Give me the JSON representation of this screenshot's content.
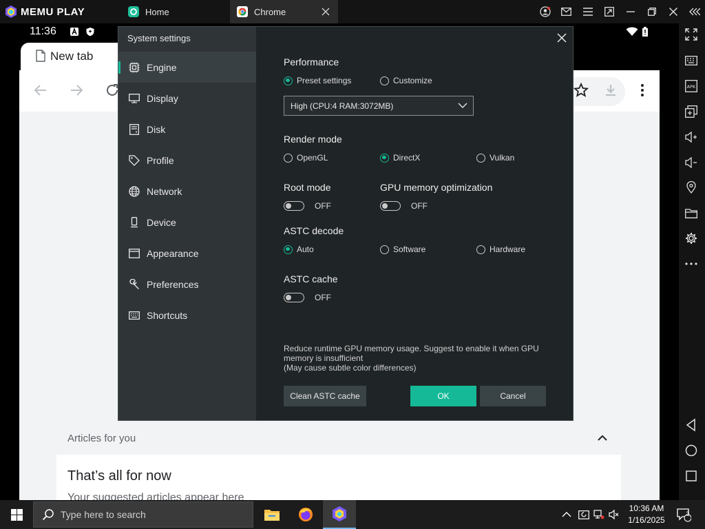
{
  "emulator": {
    "brand": "MEMU PLAY",
    "tabs": [
      {
        "label": "Home"
      },
      {
        "label": "Chrome"
      }
    ]
  },
  "android_status": {
    "time": "11:36"
  },
  "chrome": {
    "tab_title": "New tab",
    "articles_label": "Articles for you",
    "card_title": "That’s all for now",
    "card_subtitle": "Your suggested articles appear here"
  },
  "dialog": {
    "title": "System settings",
    "nav": [
      {
        "label": "Engine",
        "icon": "chip-icon",
        "active": true
      },
      {
        "label": "Display",
        "icon": "monitor-icon"
      },
      {
        "label": "Disk",
        "icon": "disk-icon"
      },
      {
        "label": "Profile",
        "icon": "tag-icon"
      },
      {
        "label": "Network",
        "icon": "globe-icon"
      },
      {
        "label": "Device",
        "icon": "phone-icon"
      },
      {
        "label": "Appearance",
        "icon": "window-icon"
      },
      {
        "label": "Preferences",
        "icon": "wrench-icon"
      },
      {
        "label": "Shortcuts",
        "icon": "keyboard-icon"
      }
    ],
    "performance": {
      "heading": "Performance",
      "options": [
        "Preset settings",
        "Customize"
      ],
      "selected": "Preset settings",
      "preset_value": "High (CPU:4 RAM:3072MB)"
    },
    "render_mode": {
      "heading": "Render mode",
      "options": [
        "OpenGL",
        "DirectX",
        "Vulkan"
      ],
      "selected": "DirectX"
    },
    "root_mode": {
      "heading": "Root mode",
      "state": "OFF"
    },
    "gpu_mem_opt": {
      "heading": "GPU memory optimization",
      "state": "OFF"
    },
    "astc_decode": {
      "heading": "ASTC decode",
      "options": [
        "Auto",
        "Software",
        "Hardware"
      ],
      "selected": "Auto"
    },
    "astc_cache": {
      "heading": "ASTC cache",
      "state": "OFF"
    },
    "note_lines": [
      "Reduce runtime GPU memory usage. Suggest to enable it when GPU",
      "memory is insufficient",
      "(May cause subtle color differences)"
    ],
    "buttons": {
      "clean": "Clean ASTC cache",
      "ok": "OK",
      "cancel": "Cancel"
    }
  },
  "taskbar": {
    "search_placeholder": "Type here to search",
    "time": "10:36 AM",
    "date": "1/16/2025",
    "notification_count": "3"
  },
  "colors": {
    "accent": "#16b997",
    "dialog_bg": "#1f2426",
    "dialog_nav_bg": "#2f3437"
  }
}
